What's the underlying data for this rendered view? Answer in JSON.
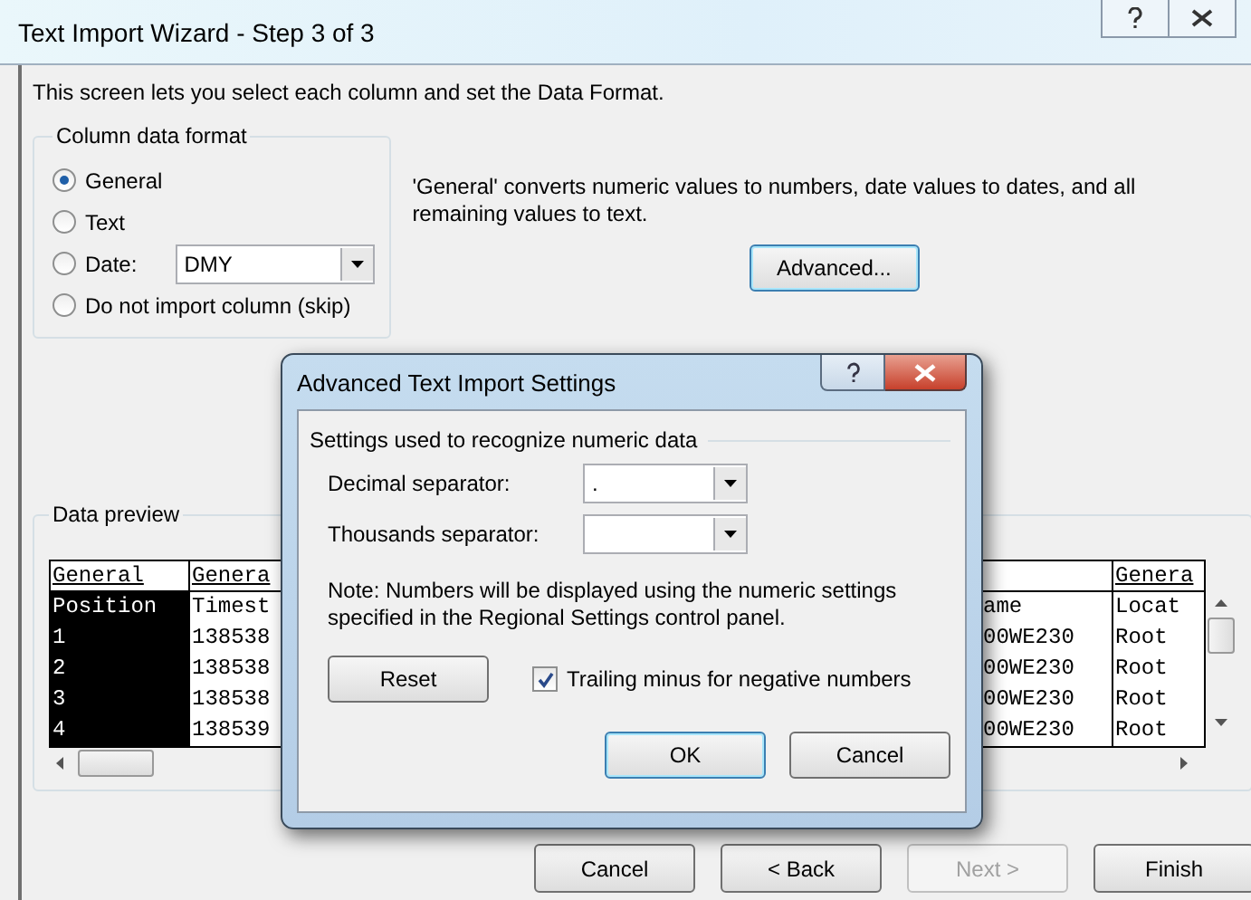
{
  "window": {
    "title": "Text Import Wizard - Step 3 of 3"
  },
  "intro": "This screen lets you select each column and set the Data Format.",
  "column_data_format": {
    "label": "Column data format",
    "options": [
      {
        "kind": "plain",
        "label": "General",
        "selected": true
      },
      {
        "kind": "plain",
        "label": "Text",
        "selected": false
      },
      {
        "kind": "date",
        "label": "Date:",
        "selected": false,
        "value": "DMY"
      },
      {
        "kind": "plain",
        "label": "Do not import column (skip)",
        "selected": false
      }
    ]
  },
  "description": "'General' converts numeric values to numbers, date values to dates, and all remaining values to text.",
  "advanced_button": "Advanced...",
  "data_preview": {
    "label": "Data preview",
    "columns": [
      {
        "header": "General",
        "selected": true,
        "cells": [
          "Position",
          "1",
          "2",
          "3",
          "4"
        ]
      },
      {
        "header": "Genera",
        "selected": false,
        "cells": [
          "Timest",
          "138538",
          "138538",
          "138538",
          "138539"
        ]
      },
      {
        "selected": false,
        "cells": [
          "ame",
          "00WE230",
          "00WE230",
          "00WE230",
          "00WE230"
        ]
      },
      {
        "header": "Genera",
        "selected": false,
        "cells": [
          "Locat",
          "Root",
          "Root",
          "Root",
          "Root"
        ]
      }
    ]
  },
  "buttons": [
    {
      "label": "Cancel",
      "disabled": false
    },
    {
      "label": "< Back",
      "disabled": false
    },
    {
      "label": "Next >",
      "disabled": true
    },
    {
      "label": "Finish",
      "disabled": false
    }
  ],
  "dialog": {
    "title": "Advanced Text Import Settings",
    "group": "Settings used to recognize numeric data",
    "fields": [
      {
        "label": "Decimal separator:",
        "value": "."
      },
      {
        "label": "Thousands separator:"
      }
    ],
    "note": "Note: Numbers will be displayed using the numeric settings specified in the Regional Settings control panel.",
    "reset": "Reset",
    "trailing_minus": {
      "label": "Trailing minus for negative numbers",
      "checked": true
    },
    "buttons": [
      {
        "label": "OK",
        "default": true
      },
      {
        "label": "Cancel",
        "default": false
      }
    ]
  }
}
